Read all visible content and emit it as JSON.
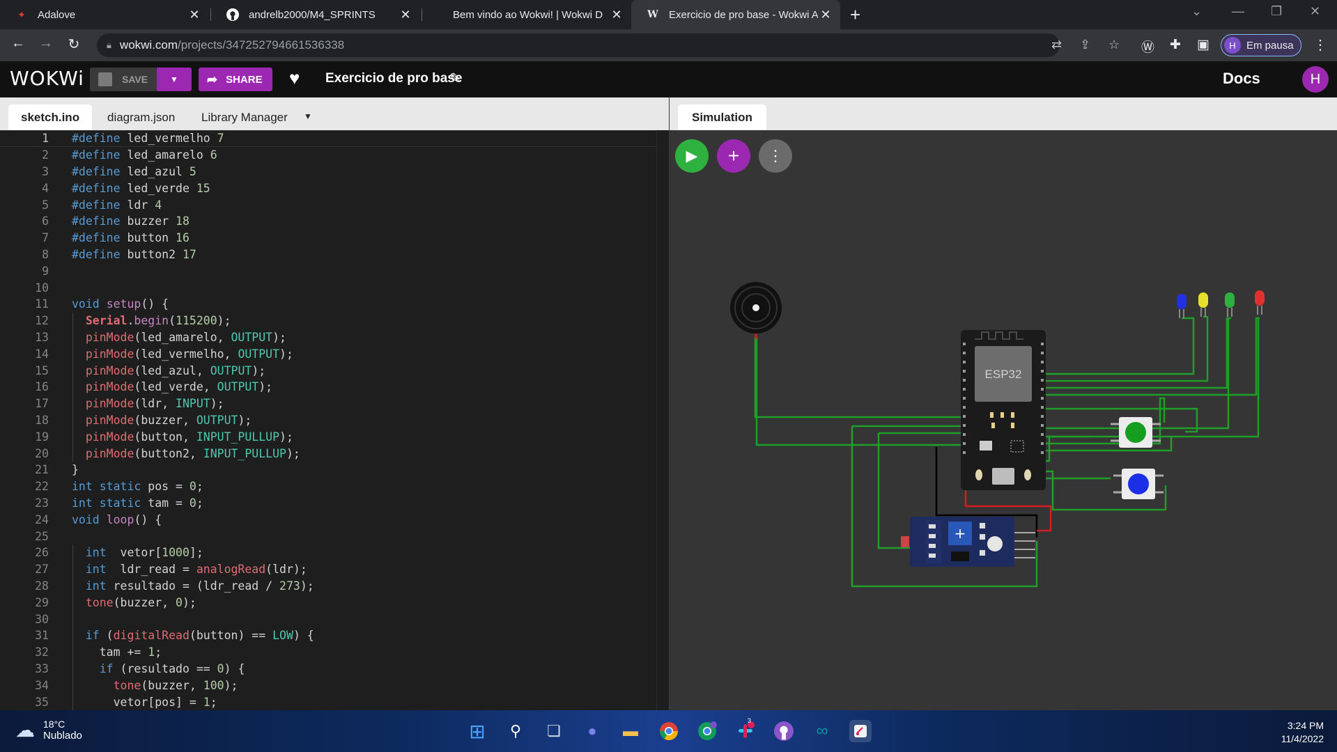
{
  "browser": {
    "tabs": [
      {
        "title": "Adalove",
        "favicon": "adalove-icon"
      },
      {
        "title": "andrelb2000/M4_SPRINTS",
        "favicon": "github-icon"
      },
      {
        "title": "Bem vindo ao Wokwi! | Wokwi D",
        "favicon": "none"
      },
      {
        "title": "Exercicio de pro base - Wokwi Ar",
        "favicon": "wokwi-icon"
      }
    ],
    "url_host": "wokwi.com",
    "url_path": "/projects/347252794661536338",
    "profile_initial": "H",
    "profile_label": "Em pausa"
  },
  "wokwi": {
    "logo": "WOKWi",
    "save_label": "SAVE",
    "share_label": "SHARE",
    "project_name": "Exercicio de pro base",
    "docs_label": "Docs",
    "user_initial": "H",
    "accent": "#9c27b0"
  },
  "editor": {
    "tabs": [
      "sketch.ino",
      "diagram.json",
      "Library Manager"
    ],
    "active_tab": "sketch.ino",
    "lines": [
      [
        [
          "h",
          "#define"
        ],
        [
          "t",
          " led_vermelho "
        ],
        [
          "n",
          "7"
        ]
      ],
      [
        [
          "h",
          "#define"
        ],
        [
          "t",
          " led_amarelo "
        ],
        [
          "n",
          "6"
        ]
      ],
      [
        [
          "h",
          "#define"
        ],
        [
          "t",
          " led_azul "
        ],
        [
          "n",
          "5"
        ]
      ],
      [
        [
          "h",
          "#define"
        ],
        [
          "t",
          " led_verde "
        ],
        [
          "n",
          "15"
        ]
      ],
      [
        [
          "h",
          "#define"
        ],
        [
          "t",
          " ldr "
        ],
        [
          "n",
          "4"
        ]
      ],
      [
        [
          "h",
          "#define"
        ],
        [
          "t",
          " buzzer "
        ],
        [
          "n",
          "18"
        ]
      ],
      [
        [
          "h",
          "#define"
        ],
        [
          "t",
          " button "
        ],
        [
          "n",
          "16"
        ]
      ],
      [
        [
          "h",
          "#define"
        ],
        [
          "t",
          " button2 "
        ],
        [
          "n",
          "17"
        ]
      ],
      [],
      [],
      [
        [
          "k",
          "void"
        ],
        [
          "t",
          " "
        ],
        [
          "f",
          "setup"
        ],
        [
          "t",
          "() {"
        ]
      ],
      [
        [
          "t",
          "  "
        ],
        [
          "s",
          "Serial"
        ],
        [
          "t",
          "."
        ],
        [
          "f",
          "begin"
        ],
        [
          "t",
          "("
        ],
        [
          "n",
          "115200"
        ],
        [
          "t",
          ");"
        ]
      ],
      [
        [
          "t",
          "  "
        ],
        [
          "fn",
          "pinMode"
        ],
        [
          "t",
          "(led_amarelo, "
        ],
        [
          "c",
          "OUTPUT"
        ],
        [
          "t",
          ");"
        ]
      ],
      [
        [
          "t",
          "  "
        ],
        [
          "fn",
          "pinMode"
        ],
        [
          "t",
          "(led_vermelho, "
        ],
        [
          "c",
          "OUTPUT"
        ],
        [
          "t",
          ");"
        ]
      ],
      [
        [
          "t",
          "  "
        ],
        [
          "fn",
          "pinMode"
        ],
        [
          "t",
          "(led_azul, "
        ],
        [
          "c",
          "OUTPUT"
        ],
        [
          "t",
          ");"
        ]
      ],
      [
        [
          "t",
          "  "
        ],
        [
          "fn",
          "pinMode"
        ],
        [
          "t",
          "(led_verde, "
        ],
        [
          "c",
          "OUTPUT"
        ],
        [
          "t",
          ");"
        ]
      ],
      [
        [
          "t",
          "  "
        ],
        [
          "fn",
          "pinMode"
        ],
        [
          "t",
          "(ldr, "
        ],
        [
          "c",
          "INPUT"
        ],
        [
          "t",
          ");"
        ]
      ],
      [
        [
          "t",
          "  "
        ],
        [
          "fn",
          "pinMode"
        ],
        [
          "t",
          "(buzzer, "
        ],
        [
          "c",
          "OUTPUT"
        ],
        [
          "t",
          ");"
        ]
      ],
      [
        [
          "t",
          "  "
        ],
        [
          "fn",
          "pinMode"
        ],
        [
          "t",
          "(button, "
        ],
        [
          "c",
          "INPUT_PULLUP"
        ],
        [
          "t",
          ");"
        ]
      ],
      [
        [
          "t",
          "  "
        ],
        [
          "fn",
          "pinMode"
        ],
        [
          "t",
          "(button2, "
        ],
        [
          "c",
          "INPUT_PULLUP"
        ],
        [
          "t",
          ");"
        ]
      ],
      [
        [
          "t",
          "}"
        ]
      ],
      [
        [
          "k",
          "int"
        ],
        [
          "t",
          " "
        ],
        [
          "k",
          "static"
        ],
        [
          "t",
          " pos = "
        ],
        [
          "n",
          "0"
        ],
        [
          "t",
          ";"
        ]
      ],
      [
        [
          "k",
          "int"
        ],
        [
          "t",
          " "
        ],
        [
          "k",
          "static"
        ],
        [
          "t",
          " tam = "
        ],
        [
          "n",
          "0"
        ],
        [
          "t",
          ";"
        ]
      ],
      [
        [
          "k",
          "void"
        ],
        [
          "t",
          " "
        ],
        [
          "f",
          "loop"
        ],
        [
          "t",
          "() {"
        ]
      ],
      [],
      [
        [
          "t",
          "  "
        ],
        [
          "k",
          "int"
        ],
        [
          "t",
          "  vetor["
        ],
        [
          "n",
          "1000"
        ],
        [
          "t",
          "];"
        ]
      ],
      [
        [
          "t",
          "  "
        ],
        [
          "k",
          "int"
        ],
        [
          "t",
          "  ldr_read = "
        ],
        [
          "fn",
          "analogRead"
        ],
        [
          "t",
          "(ldr);"
        ]
      ],
      [
        [
          "t",
          "  "
        ],
        [
          "k",
          "int"
        ],
        [
          "t",
          " resultado = (ldr_read / "
        ],
        [
          "n",
          "273"
        ],
        [
          "t",
          ");"
        ]
      ],
      [
        [
          "t",
          "  "
        ],
        [
          "fn",
          "tone"
        ],
        [
          "t",
          "(buzzer, "
        ],
        [
          "n",
          "0"
        ],
        [
          "t",
          ");"
        ]
      ],
      [],
      [
        [
          "t",
          "  "
        ],
        [
          "k",
          "if"
        ],
        [
          "t",
          " ("
        ],
        [
          "fn",
          "digitalRead"
        ],
        [
          "t",
          "(button) == "
        ],
        [
          "c",
          "LOW"
        ],
        [
          "t",
          ") {"
        ]
      ],
      [
        [
          "t",
          "    tam += "
        ],
        [
          "n",
          "1"
        ],
        [
          "t",
          ";"
        ]
      ],
      [
        [
          "t",
          "    "
        ],
        [
          "k",
          "if"
        ],
        [
          "t",
          " (resultado == "
        ],
        [
          "n",
          "0"
        ],
        [
          "t",
          ") {"
        ]
      ],
      [
        [
          "t",
          "      "
        ],
        [
          "fn",
          "tone"
        ],
        [
          "t",
          "(buzzer, "
        ],
        [
          "n",
          "100"
        ],
        [
          "t",
          ");"
        ]
      ],
      [
        [
          "t",
          "      vetor[pos] = "
        ],
        [
          "n",
          "1"
        ],
        [
          "t",
          ";"
        ]
      ]
    ]
  },
  "simulation": {
    "tab_label": "Simulation",
    "chip_label": "ESP32",
    "colors": {
      "play": "#2fb140",
      "add": "#9c27b0",
      "more": "#6b6b6b",
      "wire_green": "#1f9e2a",
      "wire_red": "#d11f1f",
      "wire_black": "#000000"
    },
    "leds": [
      "blue",
      "yellow",
      "green",
      "red"
    ],
    "buttons": [
      "green",
      "blue"
    ]
  },
  "taskbar": {
    "temperature": "18°C",
    "weather": "Nublado",
    "time": "3:24 PM",
    "date": "11/4/2022",
    "slack_badge": "3"
  }
}
